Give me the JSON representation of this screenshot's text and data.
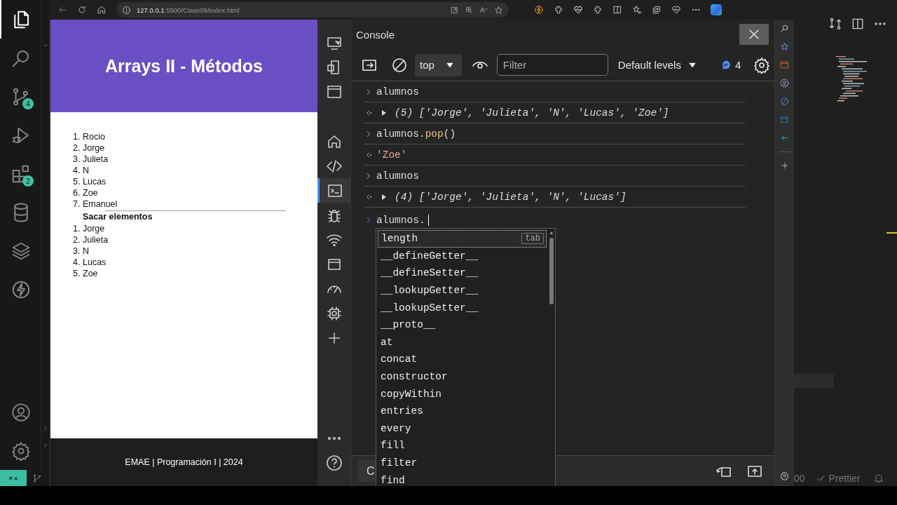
{
  "activity_bar": {
    "items": [
      {
        "selected": true
      },
      {
        "selected": false
      },
      {
        "selected": false,
        "badge": "4"
      },
      {
        "selected": false
      },
      {
        "selected": false,
        "badge": "2"
      },
      {
        "selected": false
      },
      {
        "selected": false
      },
      {
        "selected": false
      }
    ]
  },
  "browser": {
    "address": "**127.0.0.1**:5500/Clase09/index.html"
  },
  "page": {
    "title": "Arrays II - Métodos",
    "list": [
      {
        "number": "1.",
        "text": "Rocio"
      },
      {
        "number": "2.",
        "text": "Jorge"
      },
      {
        "number": "3.",
        "text": "Julieta"
      },
      {
        "number": "4.",
        "text": "N"
      },
      {
        "number": "5.",
        "text": "Lucas"
      },
      {
        "number": "6.",
        "text": "Zoe"
      },
      {
        "number": "7.",
        "text": "Emanuel"
      }
    ],
    "section_title": "Sacar elementos",
    "list_after": [
      {
        "number": "1.",
        "text": "Jorge"
      },
      {
        "number": "2.",
        "text": "Julieta"
      },
      {
        "number": "3.",
        "text": "N"
      },
      {
        "number": "4.",
        "text": "Lucas"
      },
      {
        "number": "5.",
        "text": "Zoe"
      }
    ],
    "footer": "EMAE | Programación I | 2024"
  },
  "devtools": {
    "tools": [
      {
        "selected": false
      },
      {
        "selected": false
      },
      {
        "selected": false
      },
      {
        "selected": false
      },
      {
        "selected": false
      },
      {
        "selected": true
      },
      {
        "selected": false
      },
      {
        "selected": false
      },
      {
        "selected": false
      },
      {
        "selected": false
      },
      {
        "selected": false
      }
    ],
    "title": "Console",
    "context": "top",
    "filter_placeholder": "Filter",
    "levels": "Default levels",
    "message_count": "4",
    "entries": [
      {
        "kind": "input",
        "parts": [
          {
            "kind": "plain",
            "text": "alumnos"
          }
        ]
      },
      {
        "kind": "array",
        "expanded": false,
        "count": "(5)",
        "value": "['Jorge', 'Julieta', 'N', 'Lucas', 'Zoe']"
      },
      {
        "kind": "input",
        "parts": [
          {
            "kind": "plain",
            "text": "alumnos."
          },
          {
            "kind": "method",
            "text": "pop"
          },
          {
            "kind": "plain",
            "text": "()"
          }
        ]
      },
      {
        "kind": "string",
        "text": "'Zoe'"
      },
      {
        "kind": "input",
        "parts": [
          {
            "kind": "plain",
            "text": "alumnos"
          }
        ]
      },
      {
        "kind": "array",
        "expanded": false,
        "count": "(4)",
        "value": "['Jorge', 'Julieta', 'N', 'Lucas']"
      }
    ],
    "prompt": "alumnos.",
    "autocomplete": [
      {
        "label": "length",
        "selected": true,
        "hint": "tab"
      },
      {
        "label": "__defineGetter__",
        "selected": false
      },
      {
        "label": "__defineSetter__",
        "selected": false
      },
      {
        "label": "__lookupGetter__",
        "selected": false
      },
      {
        "label": "__lookupSetter__",
        "selected": false
      },
      {
        "label": "__proto__",
        "selected": false
      },
      {
        "label": "at",
        "selected": false
      },
      {
        "label": "concat",
        "selected": false
      },
      {
        "label": "constructor",
        "selected": false
      },
      {
        "label": "copyWithin",
        "selected": false
      },
      {
        "label": "entries",
        "selected": false
      },
      {
        "label": "every",
        "selected": false
      },
      {
        "label": "fill",
        "selected": false
      },
      {
        "label": "filter",
        "selected": false
      },
      {
        "label": "find",
        "selected": false
      }
    ],
    "drawer_tab": "C"
  },
  "status_bar": {
    "partial": "00",
    "formatter": "Prettier"
  }
}
